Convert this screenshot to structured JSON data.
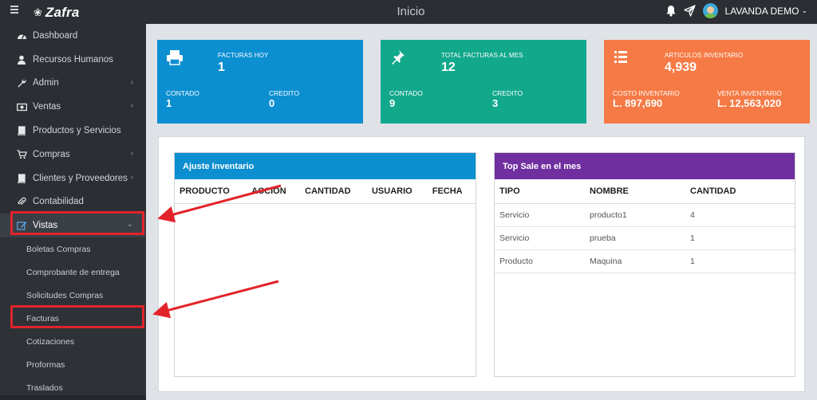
{
  "app": {
    "logo_text": "Zafra",
    "page_title": "Inicio",
    "user_name": "LAVANDA DEMO"
  },
  "sidebar": {
    "items": [
      {
        "label": "Dashboard",
        "icon": "dashboard-icon",
        "chevron": false
      },
      {
        "label": "Recursos Humanos",
        "icon": "user-icon",
        "chevron": false
      },
      {
        "label": "Admin",
        "icon": "wrench-icon",
        "chevron": true
      },
      {
        "label": "Ventas",
        "icon": "money-icon",
        "chevron": true
      },
      {
        "label": "Productos y Servicios",
        "icon": "book-icon",
        "chevron": false
      },
      {
        "label": "Compras",
        "icon": "cart-icon",
        "chevron": true
      },
      {
        "label": "Clientes y Proveedores",
        "icon": "book-icon",
        "chevron": true
      },
      {
        "label": "Contabilidad",
        "icon": "paperclip-icon",
        "chevron": false
      },
      {
        "label": "Vistas",
        "icon": "edit-icon",
        "chevron": true
      }
    ],
    "sub_items": [
      "Boletas Compras",
      "Comprobante de entrega",
      "Solicitudes Compras",
      "Facturas",
      "Cotizaciones",
      "Proformas",
      "Traslados"
    ]
  },
  "stats": [
    {
      "title": "FACTURAS HOY",
      "value": "1",
      "left_label": "CONTADO",
      "left_value": "1",
      "right_label": "CREDITO",
      "right_value": "0",
      "color": "#0b8fd1",
      "icon": "printer-icon"
    },
    {
      "title": "TOTAL FACTURAS AL MES",
      "value": "12",
      "left_label": "CONTADO",
      "left_value": "9",
      "right_label": "CREDITO",
      "right_value": "3",
      "color": "#12a88c",
      "icon": "pin-icon"
    },
    {
      "title": "ARTICULOS INVENTARIO",
      "value": "4,939",
      "left_label": "COSTO INVENTARIO",
      "left_value": "L. 897,690",
      "right_label": "VENTA INVENTARIO",
      "right_value": "L. 12,563,020",
      "color": "#f57a45",
      "icon": "list-icon"
    }
  ],
  "ajuste": {
    "title": "Ajuste Inventario",
    "color": "#0b8fd1",
    "columns": [
      "PRODUCTO",
      "ACCIÓN",
      "CANTIDAD",
      "USUARIO",
      "FECHA"
    ]
  },
  "topsale": {
    "title": "Top Sale en el mes",
    "color": "#6f2f9f",
    "columns": [
      "TIPO",
      "NOMBRE",
      "CANTIDAD"
    ],
    "rows": [
      [
        "Servicio",
        "producto1",
        "4"
      ],
      [
        "Servicio",
        "prueba",
        "1"
      ],
      [
        "Producto",
        "Maquina",
        "1"
      ]
    ]
  },
  "annotations": {
    "highlight_color": "#e3232a"
  }
}
